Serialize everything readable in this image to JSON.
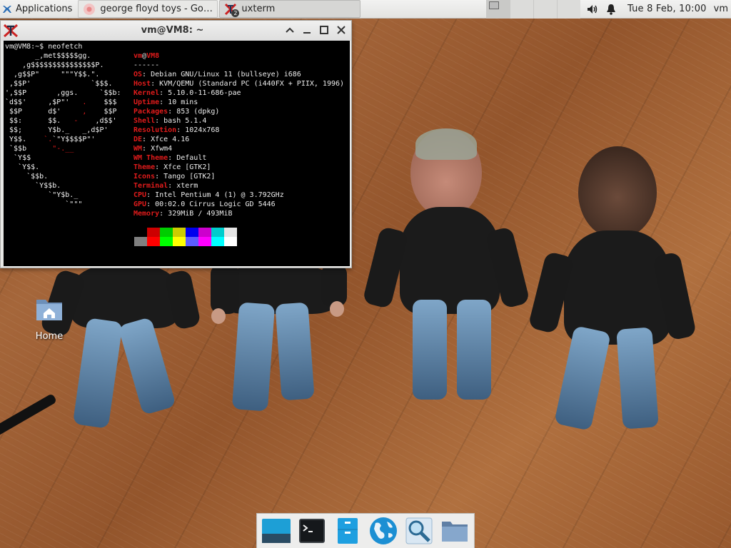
{
  "panel": {
    "apps_label": "Applications",
    "tasks": [
      {
        "label": "george floyd toys - Goo...",
        "icon": "chrome-icon"
      },
      {
        "label": "uxterm",
        "icon": "xterm-icon",
        "badge": "2"
      }
    ],
    "clock": "Tue  8 Feb, 10:00",
    "user": "vm",
    "colors": {
      "panel_bg": "#e9e9e7"
    }
  },
  "terminal": {
    "title": "vm@VM8: ~",
    "prompt": "vm@VM8:~$ neofetch",
    "user": "vm",
    "at": "@",
    "host": "VM8",
    "separator": "------",
    "info": [
      {
        "key": "OS",
        "value": "Debian GNU/Linux 11 (bullseye) i686"
      },
      {
        "key": "Host",
        "value": "KVM/QEMU (Standard PC (i440FX + PIIX, 1996)"
      },
      {
        "key": "Kernel",
        "value": "5.10.0-11-686-pae"
      },
      {
        "key": "Uptime",
        "value": "10 mins"
      },
      {
        "key": "Packages",
        "value": "853 (dpkg)"
      },
      {
        "key": "Shell",
        "value": "bash 5.1.4"
      },
      {
        "key": "Resolution",
        "value": "1024x768"
      },
      {
        "key": "DE",
        "value": "Xfce 4.16"
      },
      {
        "key": "WM",
        "value": "Xfwm4"
      },
      {
        "key": "WM Theme",
        "value": "Default"
      },
      {
        "key": "Theme",
        "value": "Xfce [GTK2]"
      },
      {
        "key": "Icons",
        "value": "Tango [GTK2]"
      },
      {
        "key": "Terminal",
        "value": "xterm"
      },
      {
        "key": "CPU",
        "value": "Intel Pentium 4 (1) @ 3.792GHz"
      },
      {
        "key": "GPU",
        "value": "00:02.0 Cirrus Logic GD 5446"
      },
      {
        "key": "Memory",
        "value": "329MiB / 493MiB"
      }
    ],
    "palette_dark": [
      "#000000",
      "#cd0000",
      "#00cd00",
      "#cdcd00",
      "#0000ee",
      "#cd00cd",
      "#00cdcd",
      "#e5e5e5"
    ],
    "palette_bright": [
      "#7f7f7f",
      "#ff0000",
      "#00ff00",
      "#ffff00",
      "#5c5cff",
      "#ff00ff",
      "#00ffff",
      "#ffffff"
    ]
  },
  "desktop": {
    "home_label": "Home"
  },
  "dock": {
    "items": [
      "show-desktop-icon",
      "terminal-icon",
      "file-manager-icon",
      "web-browser-icon",
      "app-finder-icon",
      "folder-icon"
    ]
  }
}
